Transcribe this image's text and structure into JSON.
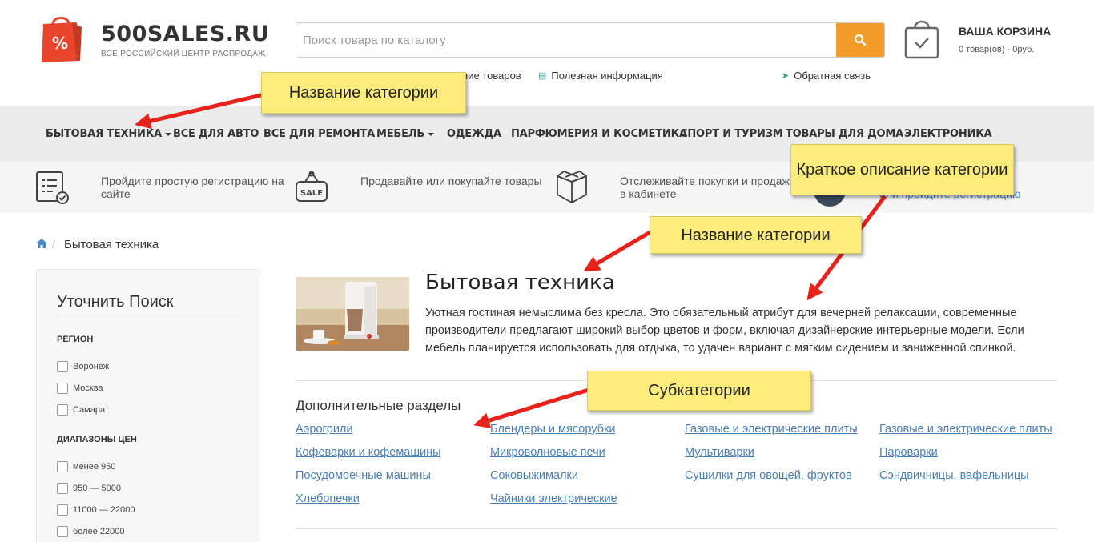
{
  "header": {
    "logo": "500SALES.RU",
    "tagline": "ВСЕ РОССИЙСКИЙ ЦЕНТР РАСПРОДАЖ.",
    "search_placeholder": "Поиск товара по каталогу",
    "cart_title": "ВАША КОРЗИНА",
    "cart_status": "0 товар(ов) - 0руб.",
    "link_compare": "Сравнение товаров",
    "link_info": "Полезная информация",
    "link_feedback": "Обратная связь"
  },
  "nav": {
    "items": [
      "БЫТОВАЯ ТЕХНИКА",
      "ВСЕ ДЛЯ АВТО",
      "ВСЕ ДЛЯ РЕМОНТА",
      "МЕБЕЛЬ",
      "ОДЕЖДА",
      "ПАРФЮМЕРИЯ И КОСМЕТИКА",
      "СПОРТ И ТУРИЗМ",
      "ТОВАРЫ ДЛЯ ДОМА",
      "ЭЛЕКТРОНИКА"
    ]
  },
  "benefits": {
    "items": [
      {
        "text": "Пройдите простую регистрацию на сайте",
        "icon": "checklist-icon"
      },
      {
        "text": "Продавайте или покупайте товары",
        "icon": "sale-tag-icon"
      },
      {
        "text": "Отслеживайте покупки и продажи в кабинете",
        "icon": "box-icon"
      }
    ],
    "reg_link": "или пройдите регистрацию"
  },
  "breadcrumb": {
    "current": "Бытовая техника"
  },
  "sidebar": {
    "title": "Уточнить Поиск",
    "region_head": "РЕГИОН",
    "regions": [
      "Воронеж",
      "Москва",
      "Самара"
    ],
    "price_head": "ДИАПАЗОНЫ ЦЕН",
    "prices": [
      "менее 950",
      "950 — 5000",
      "11000 — 22000",
      "более 22000"
    ]
  },
  "category": {
    "title": "Бытовая техника",
    "description": "Уютная гостиная немыслима без кресла. Это обязательный атрибут для вечерней релаксации, современные производители предлагают широкий выбор цветов и форм, включая дизайнерские интерьерные модели. Если мебель планируется использовать для отдыха, то удачен вариант с мягким сидением и заниженной спинкой.",
    "subsections_title": "Дополнительные разделы",
    "subsections": [
      "Аэрогрили",
      "Блендеры и мясорубки",
      "Газовые и электрические плиты",
      "Газовые и электрические плиты",
      "Кофеварки и кофемашины",
      "Микроволновые печи",
      "Мультиварки",
      "Пароварки",
      "Посудомоечные машины",
      "Соковыжималки",
      "Сушилки для овощей, фруктов",
      "Сэндвичницы, вафельницы",
      "Хлебопечки",
      "Чайники электрические"
    ]
  },
  "annotations": {
    "nav_category": "Название категории",
    "description": "Краткое описание категории",
    "title": "Название категории",
    "subcategories": "Субкатегории"
  },
  "colors": {
    "accent": "#f39c2b",
    "logo_red": "#e8452c",
    "link": "#4a7fb5",
    "note_bg": "#fcec7c",
    "arrow": "#e8211a"
  }
}
